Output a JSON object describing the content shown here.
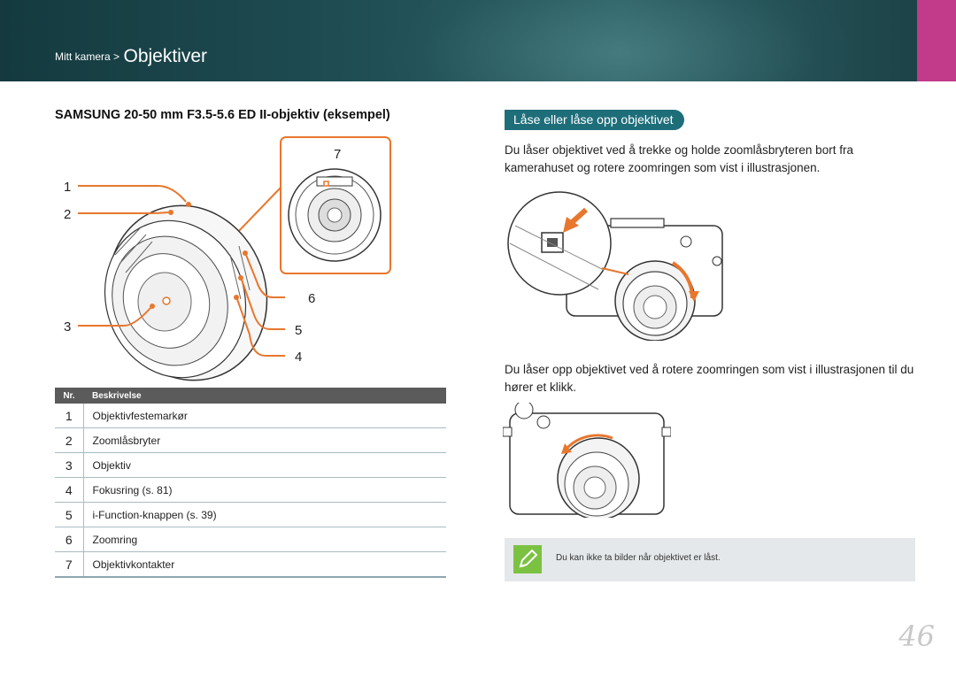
{
  "header": {
    "breadcrumb_small": "Mitt kamera >",
    "breadcrumb_big": "Objektiver",
    "accent_color": "#c23a8a"
  },
  "left": {
    "title": "SAMSUNG 20-50 mm F3.5-5.6 ED II-objektiv (eksempel)",
    "callouts": [
      "1",
      "2",
      "3",
      "4",
      "5",
      "6",
      "7"
    ],
    "table": {
      "headers": [
        "Nr.",
        "Beskrivelse"
      ],
      "rows": [
        {
          "nr": "1",
          "text": "Objektivfestemarkør"
        },
        {
          "nr": "2",
          "text": "Zoomlåsbryter"
        },
        {
          "nr": "3",
          "text": "Objektiv"
        },
        {
          "nr": "4",
          "text": "Fokusring (s. 81)"
        },
        {
          "nr": "5",
          "text": "i-Function-knappen (s. 39)"
        },
        {
          "nr": "6",
          "text": "Zoomring"
        },
        {
          "nr": "7",
          "text": "Objektivkontakter"
        }
      ]
    }
  },
  "right": {
    "section_title": "Låse eller låse opp objektivet",
    "para1": "Du låser objektivet ved å trekke og holde zoomlåsbryteren bort fra kamerahuset og rotere zoomringen som vist i illustrasjonen.",
    "para2": "Du låser opp objektivet ved å rotere zoomringen som vist i illustrasjonen til du hører et klikk.",
    "note_icon": "pencil-note-icon",
    "note": "Du kan ikke ta bilder når objektivet er låst."
  },
  "page_number": "46"
}
